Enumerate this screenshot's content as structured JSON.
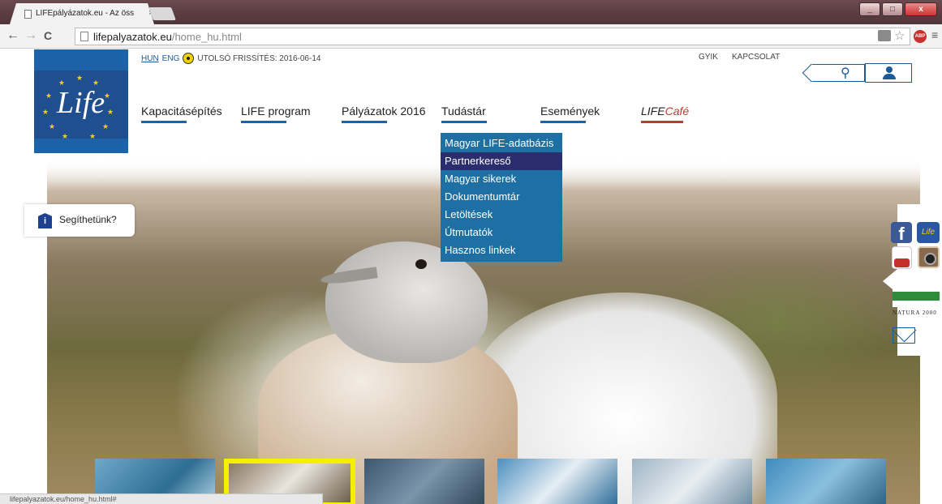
{
  "browser": {
    "tab_title": "LIFEpályázatok.eu - Az öss",
    "tab_close": "×",
    "url_domain": "lifepalyazatok.eu",
    "url_path": "/home_hu.html",
    "back": "←",
    "forward": "→",
    "reload": "C",
    "min": "_",
    "max": "□",
    "close": "x",
    "abp_label": "ABP",
    "status_url": "lifepalyazatok.eu/home_hu.html#"
  },
  "topbar": {
    "lang_hun": "HUN",
    "lang_eng": "ENG",
    "updated": "UTOLSÓ FRISSÍTÉS: 2016-06-14",
    "faq": "GYIK",
    "contact": "KAPCSOLAT"
  },
  "logo": {
    "text": "Life"
  },
  "nav": {
    "items": [
      {
        "label": "Kapacitásépítés"
      },
      {
        "label": "LIFE program"
      },
      {
        "label": "Pályázatok 2016"
      },
      {
        "label": "Tudástár"
      },
      {
        "label": "Események"
      }
    ],
    "cafe_prefix": "LIFE",
    "cafe_suffix": "Café"
  },
  "dropdown": {
    "items": [
      {
        "label": "Magyar LIFE-adatbázis"
      },
      {
        "label": "Partnerkereső"
      },
      {
        "label": "Magyar sikerek"
      },
      {
        "label": "Dokumentumtár"
      },
      {
        "label": "Letöltések"
      },
      {
        "label": "Útmutatók"
      },
      {
        "label": "Hasznos linkek"
      }
    ],
    "active_index": 1
  },
  "help": {
    "icon": "i",
    "label": "Segíthetünk?"
  },
  "social": {
    "facebook": "f",
    "life": "Life",
    "natura": "NATURA 2000"
  },
  "icons": {
    "search": "search-icon",
    "user": "user-icon",
    "radio": "radiation-icon",
    "mail": "mail-icon"
  },
  "colors": {
    "brand_blue": "#1c62a8",
    "dropdown_bg": "#1e6fa4",
    "dropdown_active": "#2a2d6e",
    "cafe_red": "#c0392b",
    "thumb_highlight": "#f5f000"
  }
}
